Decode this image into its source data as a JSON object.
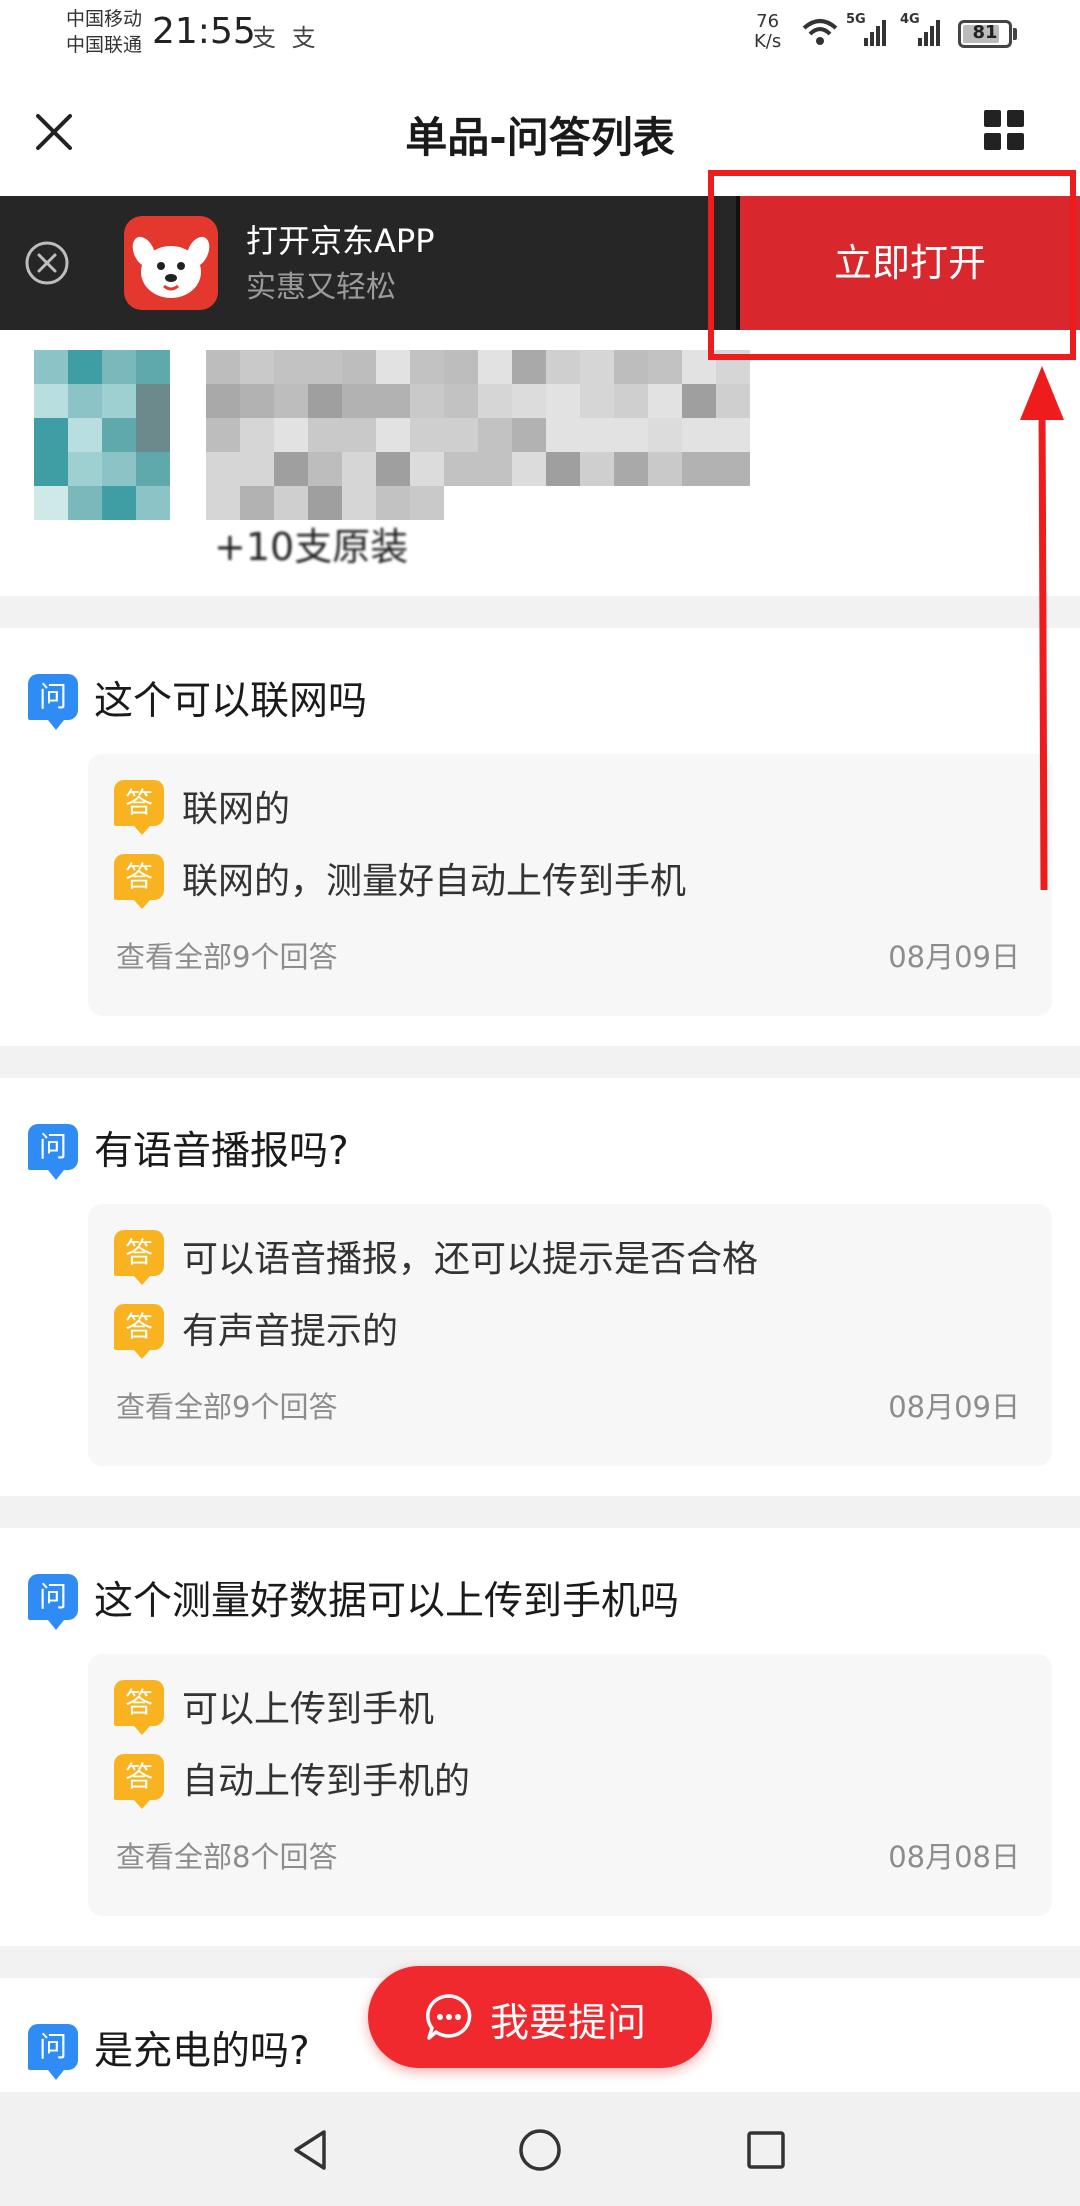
{
  "status_bar": {
    "carrier_1": "中国移动",
    "carrier_2": "中国联通",
    "time": "21:55",
    "mini_icons": "支 支",
    "net_speed_value": "76",
    "net_speed_unit": "K/s",
    "sim1_type": "5G",
    "sim2_type": "4G",
    "battery": "81",
    "battery_level": 0.81
  },
  "header": {
    "title": "单品-问答列表",
    "close_icon": "close-icon",
    "menu_icon": "grid-icon"
  },
  "app_banner": {
    "title": "打开京东APP",
    "subtitle": "实惠又轻松",
    "open_label": "立即打开",
    "accent": "#d8282d"
  },
  "product": {
    "tail_text": "+10支原装"
  },
  "questions": [
    {
      "badge": "问",
      "question": "这个可以联网吗",
      "answers": [
        {
          "badge": "答",
          "text": "联网的"
        },
        {
          "badge": "答",
          "text": "联网的，测量好自动上传到手机"
        }
      ],
      "view_all": "查看全部9个回答",
      "date": "08月09日"
    },
    {
      "badge": "问",
      "question": "有语音播报吗?",
      "answers": [
        {
          "badge": "答",
          "text": "可以语音播报，还可以提示是否合格"
        },
        {
          "badge": "答",
          "text": "有声音提示的"
        }
      ],
      "view_all": "查看全部9个回答",
      "date": "08月09日"
    },
    {
      "badge": "问",
      "question": "这个测量好数据可以上传到手机吗",
      "answers": [
        {
          "badge": "答",
          "text": "可以上传到手机"
        },
        {
          "badge": "答",
          "text": "自动上传到手机的"
        }
      ],
      "view_all": "查看全部8个回答",
      "date": "08月08日"
    },
    {
      "badge": "问",
      "question": "是充电的吗?",
      "answers": []
    }
  ],
  "ask_button": {
    "label": "我要提问",
    "color": "#f0292f"
  },
  "colors": {
    "question_badge": "#2f8cf5",
    "answer_badge": "#f9b321",
    "annotation": "#ee1c1c"
  }
}
